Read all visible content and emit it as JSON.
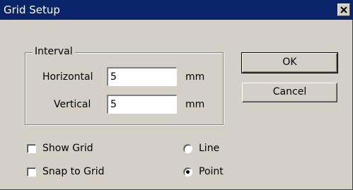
{
  "window": {
    "title": "Grid Setup",
    "close_icon": "close-icon"
  },
  "interval": {
    "group_label": "Interval",
    "horizontal_label": "Horizontal",
    "horizontal_value": "5",
    "horizontal_unit": "mm",
    "vertical_label": "Vertical",
    "vertical_value": "5",
    "vertical_unit": "mm"
  },
  "buttons": {
    "ok_label": "OK",
    "cancel_label": "Cancel"
  },
  "options": {
    "show_grid_label": "Show Grid",
    "show_grid_checked": false,
    "snap_to_grid_label": "Snap to Grid",
    "snap_to_grid_checked": false
  },
  "grid_style": {
    "line_label": "Line",
    "point_label": "Point",
    "selected": "Point"
  },
  "colors": {
    "title_bar": "#0a246a",
    "dialog_face": "#d4d0c8"
  }
}
